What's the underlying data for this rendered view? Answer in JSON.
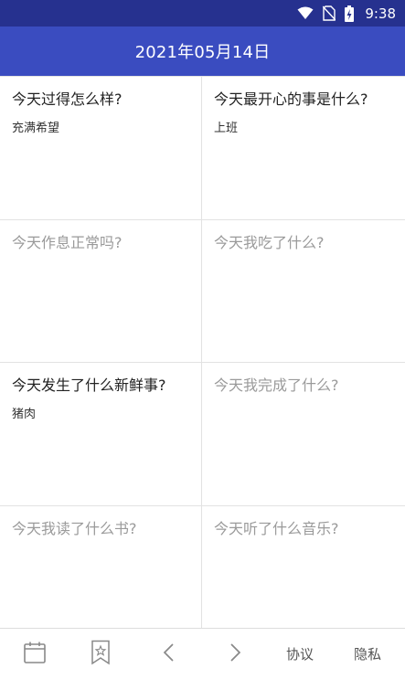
{
  "status_bar": {
    "time": "9:38",
    "icons": [
      "wifi-icon",
      "no-sim-icon",
      "battery-charging-icon"
    ]
  },
  "header": {
    "date": "2021年05月14日"
  },
  "cards": [
    {
      "question": "今天过得怎么样?",
      "answer": "充满希望"
    },
    {
      "question": "今天最开心的事是什么?",
      "answer": "上班"
    },
    {
      "question": "今天作息正常吗?",
      "answer": ""
    },
    {
      "question": "今天我吃了什么?",
      "answer": ""
    },
    {
      "question": "今天发生了什么新鲜事?",
      "answer": "猪肉"
    },
    {
      "question": "今天我完成了什么?",
      "answer": ""
    },
    {
      "question": "今天我读了什么书?",
      "answer": ""
    },
    {
      "question": "今天听了什么音乐?",
      "answer": ""
    }
  ],
  "bottom_bar": {
    "icons": [
      "calendar-icon",
      "bookmark-icon",
      "chevron-left-icon",
      "chevron-right-icon"
    ],
    "agreement_label": "协议",
    "privacy_label": "隐私"
  },
  "colors": {
    "status_bar": "#26318f",
    "header": "#3a4cc0",
    "unanswered_text": "#9a9a9a",
    "answered_text": "#222222"
  }
}
